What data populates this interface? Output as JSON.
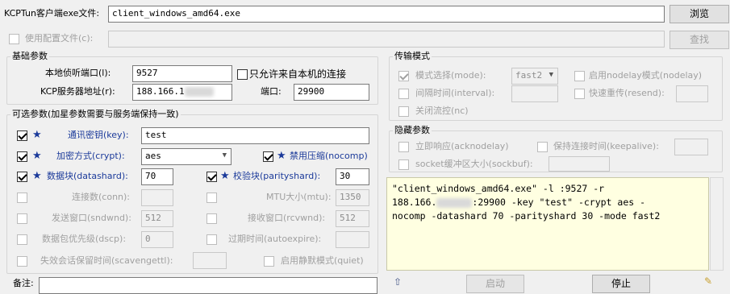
{
  "top": {
    "exe_label": "KCPTun客户端exe文件:",
    "exe_value": "client_windows_amd64.exe",
    "browse_label": "浏览",
    "config_label": "使用配置文件(c):",
    "config_value": "",
    "find_label": "查找"
  },
  "basic": {
    "title": "基础参数",
    "local_port_label": "本地侦听端口(l):",
    "local_port_value": "9527",
    "local_only_label": "只允许来自本机的连接",
    "server_addr_label": "KCP服务器地址(r):",
    "server_addr_value": "188.166.1",
    "port_label": "端口:",
    "port_value": "29900"
  },
  "optional": {
    "title": "可选参数(加星参数需要与服务端保持一致)",
    "key_label": "通讯密钥(key):",
    "key_value": "test",
    "crypt_label": "加密方式(crypt):",
    "crypt_value": "aes",
    "nocomp_label": "禁用压缩(nocomp)",
    "datashard_label": "数据块(datashard):",
    "datashard_value": "70",
    "parityshard_label": "校验块(parityshard):",
    "parityshard_value": "30",
    "conn_label": "连接数(conn):",
    "conn_value": "",
    "mtu_label": "MTU大小(mtu):",
    "mtu_value": "1350",
    "sndwnd_label": "发送窗口(sndwnd):",
    "sndwnd_value": "512",
    "rcvwnd_label": "接收窗口(rcvwnd):",
    "rcvwnd_value": "512",
    "dscp_label": "数据包优先级(dscp):",
    "dscp_value": "0",
    "autoexpire_label": "过期时间(autoexpire):",
    "autoexpire_value": "",
    "scavengettl_label": "失效会话保留时间(scavengettl):",
    "scavengettl_value": "",
    "quiet_label": "启用静默模式(quiet)"
  },
  "transfer": {
    "title": "传输模式",
    "mode_label": "模式选择(mode):",
    "mode_value": "fast2",
    "nodelay_label": "启用nodelay模式(nodelay)",
    "interval_label": "间隔时间(interval):",
    "interval_value": "",
    "resend_label": "快速重传(resend):",
    "resend_value": "",
    "nc_label": "关闭流控(nc)"
  },
  "hidden": {
    "title": "隐藏参数",
    "acknodelay_label": "立即响应(acknodelay)",
    "keepalive_label": "保持连接时间(keepalive):",
    "keepalive_value": "",
    "sockbuf_label": "socket缓冲区大小(sockbuf):",
    "sockbuf_value": ""
  },
  "command": {
    "line1": "\"client_windows_amd64.exe\" -l :9527 -r",
    "line2_pre": "188.166.",
    "line2_post": ":29900 -key \"test\" -crypt aes -",
    "line3": "nocomp -datashard 70 -parityshard 30 -mode fast2"
  },
  "bottom": {
    "note_label": "备注:",
    "start_label": "启动",
    "stop_label": "停止"
  },
  "colors": {
    "command_bg": "#ffffe1",
    "star": "#1b3a9a"
  }
}
